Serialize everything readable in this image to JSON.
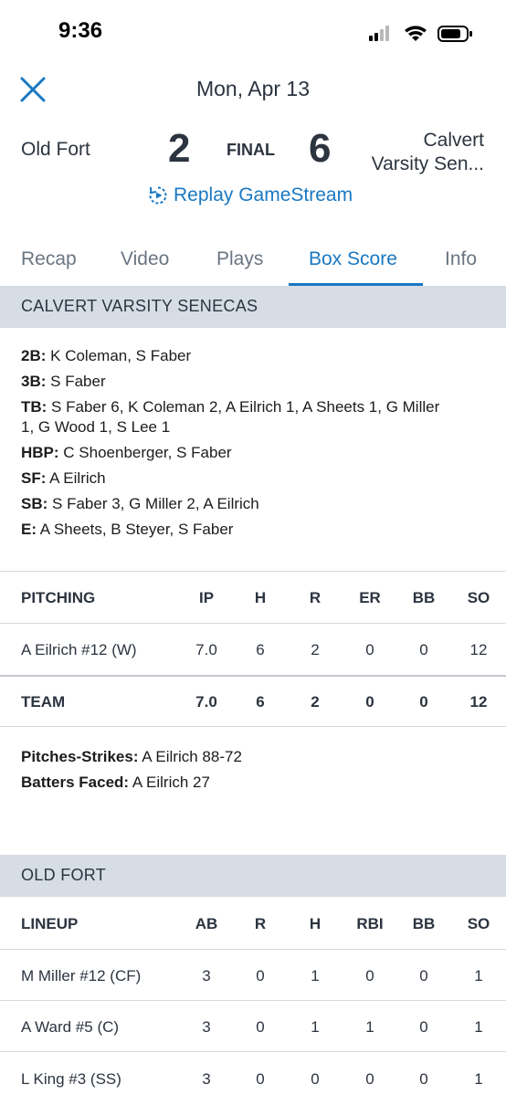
{
  "status_bar": {
    "time": "9:36",
    "icons": [
      "signal-icon",
      "wifi-icon",
      "battery-icon"
    ]
  },
  "header": {
    "date": "Mon, Apr 13",
    "away_team": "Old Fort",
    "away_score": "2",
    "status": "FINAL",
    "home_score": "6",
    "home_team_line1": "Calvert",
    "home_team_line2": "Varsity Sen...",
    "replay_label": "Replay GameStream"
  },
  "tabs": [
    "Recap",
    "Video",
    "Plays",
    "Box Score",
    "Info"
  ],
  "active_tab": "Box Score",
  "calvert": {
    "section_title": "CALVERT VARSITY SENECAS",
    "notes": [
      {
        "label": "2B:",
        "value": " K Coleman, S Faber"
      },
      {
        "label": "3B:",
        "value": " S Faber"
      },
      {
        "label": "TB:",
        "value": " S Faber 6, K Coleman 2, A Eilrich 1, A Sheets 1, G Miller"
      },
      {
        "label": "",
        "value": "1, G Wood 1, S Lee 1"
      },
      {
        "label": "HBP:",
        "value": " C Shoenberger, S Faber"
      },
      {
        "label": "SF:",
        "value": " A Eilrich"
      },
      {
        "label": "SB:",
        "value": " S Faber 3, G Miller 2, A Eilrich"
      },
      {
        "label": "E:",
        "value": " A Sheets, B Steyer, S Faber"
      }
    ],
    "pitching": {
      "columns": [
        "PITCHING",
        "IP",
        "H",
        "R",
        "ER",
        "BB",
        "SO"
      ],
      "rows": [
        [
          "A Eilrich #12 (W)",
          "7.0",
          "6",
          "2",
          "0",
          "0",
          "12"
        ]
      ],
      "team": [
        "TEAM",
        "7.0",
        "6",
        "2",
        "0",
        "0",
        "12"
      ]
    },
    "pitch_notes": [
      {
        "label": "Pitches-Strikes:",
        "value": " A Eilrich 88-72"
      },
      {
        "label": "Batters Faced:",
        "value": " A Eilrich 27"
      }
    ]
  },
  "oldfort": {
    "section_title": "OLD FORT",
    "lineup": {
      "columns": [
        "LINEUP",
        "AB",
        "R",
        "H",
        "RBI",
        "BB",
        "SO"
      ],
      "rows": [
        [
          "M Miller #12 (CF)",
          "3",
          "0",
          "1",
          "0",
          "0",
          "1"
        ],
        [
          "A Ward #5 (C)",
          "3",
          "0",
          "1",
          "1",
          "0",
          "1"
        ],
        [
          "L King #3 (SS)",
          "3",
          "0",
          "0",
          "0",
          "0",
          "1"
        ]
      ]
    }
  },
  "colors": {
    "accent": "#1a78c2",
    "section_bg": "#d6dde4",
    "text": "#2c3440"
  }
}
